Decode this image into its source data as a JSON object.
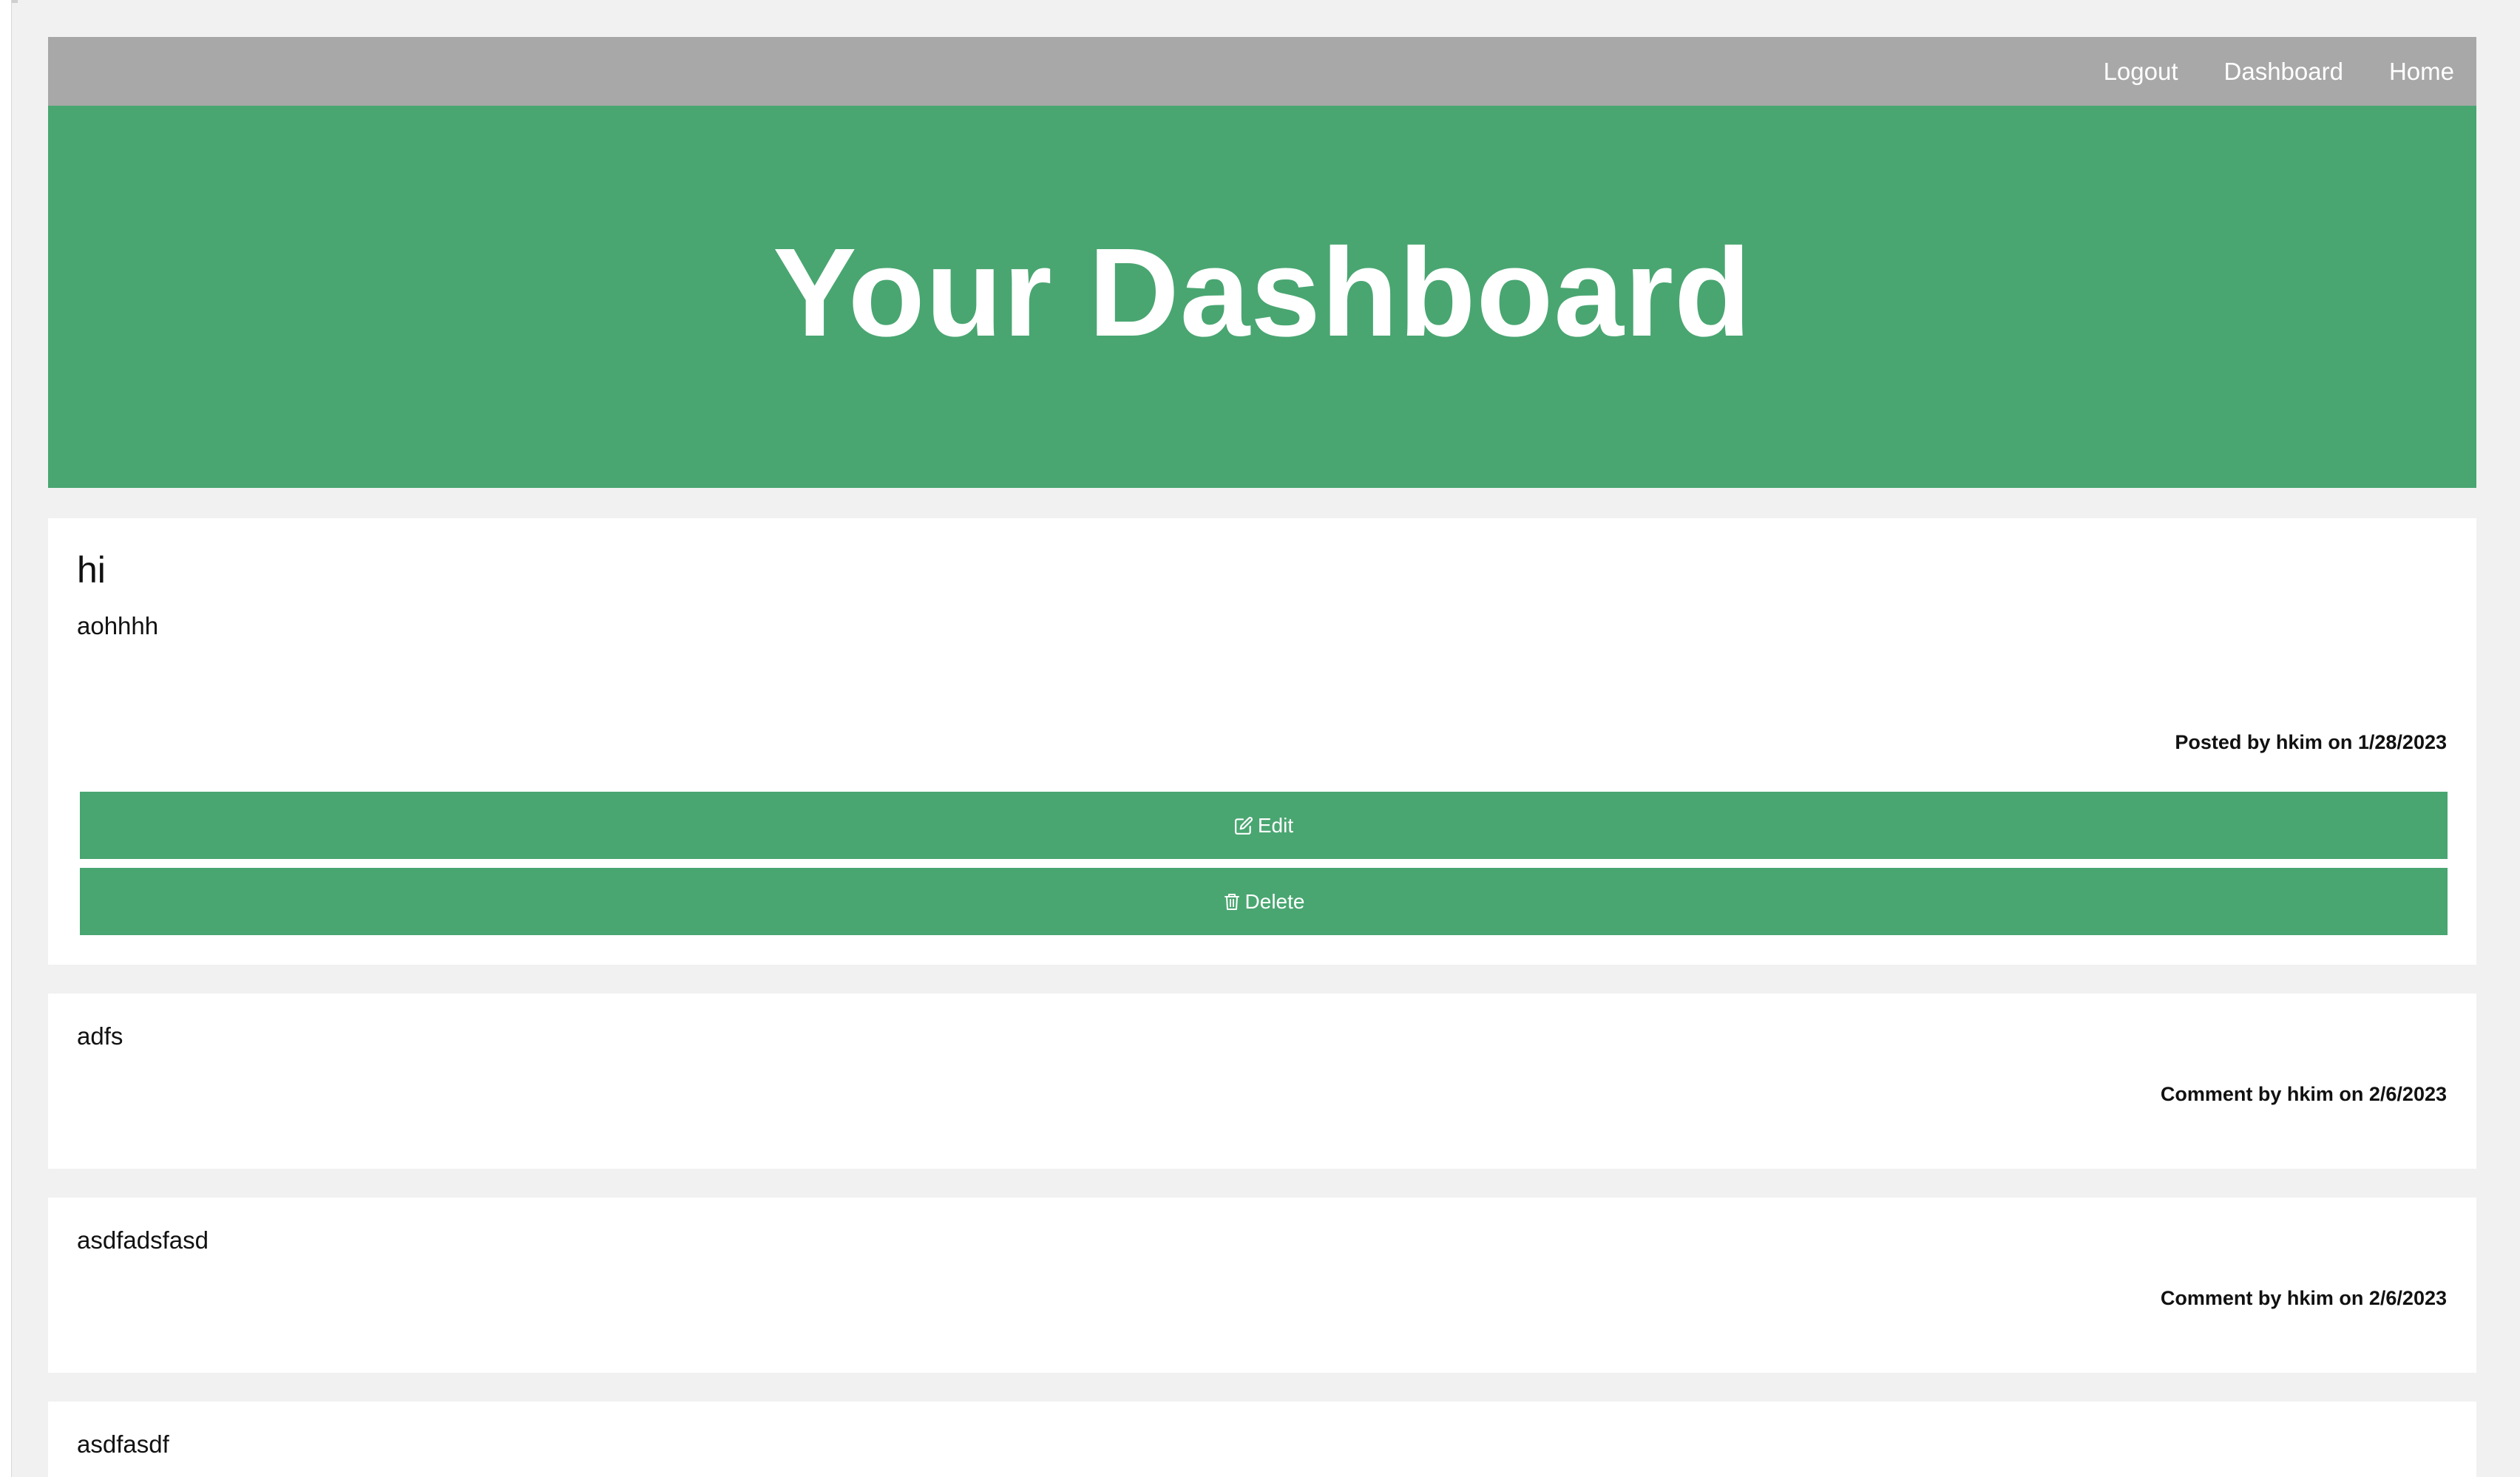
{
  "nav": {
    "links": [
      "Logout",
      "Dashboard",
      "Home"
    ]
  },
  "hero": {
    "title": "Your Dashboard"
  },
  "post": {
    "title": "hi",
    "body": "aohhhh",
    "meta": "Posted by hkim on 1/28/2023",
    "edit_label": "Edit",
    "delete_label": "Delete"
  },
  "comments": [
    {
      "body": "adfs",
      "meta": "Comment by hkim on 2/6/2023"
    },
    {
      "body": "asdfadsfasd",
      "meta": "Comment by hkim on 2/6/2023"
    },
    {
      "body": "asdfasdf"
    }
  ],
  "colors": {
    "accent": "#49a671",
    "navbar": "#a8a8a8",
    "background": "#f1f1f1"
  },
  "icons": {
    "edit": "edit-icon",
    "delete": "trash-icon"
  }
}
